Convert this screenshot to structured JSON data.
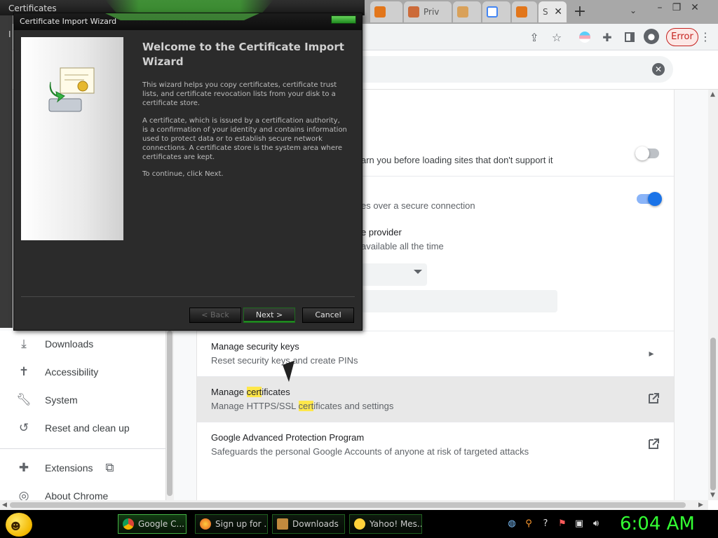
{
  "browser": {
    "tabs": [
      {
        "label": "Certificates",
        "icon": "certificates-window-icon"
      },
      {
        "label": "Priv",
        "icon": "metamask-fox-icon"
      },
      {
        "label": "",
        "icon": "google-g-icon"
      },
      {
        "label": "",
        "icon": "metamask-fox-icon"
      },
      {
        "label": "S",
        "icon": "settings-icon"
      }
    ],
    "error_button": "Error",
    "colors": {
      "accent": "#1a73e8",
      "highlight": "#ffe74a"
    }
  },
  "certs_window": {
    "title": "Certificates",
    "side_labels": [
      "I",
      "",
      ""
    ]
  },
  "wizard": {
    "title": "Certificate Import Wizard",
    "heading": "Welcome to the Certificate Import Wizard",
    "paragraphs": [
      "This wizard helps you copy certificates, certificate trust lists, and certificate revocation lists from your disk to a certificate store.",
      "A certificate, which is issued by a certification authority, is a confirmation of your identity and contains information used to protect data or to establish secure network connections. A certificate store is the system area where certificates are kept.",
      "To continue, click Next."
    ],
    "buttons": {
      "back": "< Back",
      "next": "Next >",
      "cancel": "Cancel"
    }
  },
  "settings": {
    "partial_rows": [
      "arn you before loading sites that don't support it",
      "es over a secure connection",
      "e provider",
      "available all the time"
    ],
    "rows": [
      {
        "title": "Manage security keys",
        "subtitle": "Reset security keys and create PINs"
      },
      {
        "title_parts": [
          "Manage ",
          "cert",
          "ificates"
        ],
        "subtitle_parts": [
          "Manage HTTPS/SSL ",
          "cert",
          "ificates and settings"
        ]
      },
      {
        "title": "Google Advanced Protection Program",
        "subtitle": "Safeguards the personal Google Accounts of anyone at risk of targeted attacks"
      }
    ],
    "toggles": {
      "insecure_warning": false,
      "secure_dns": true
    }
  },
  "sidebar": {
    "items": [
      {
        "label": "Downloads",
        "icon": "download-icon"
      },
      {
        "label": "Accessibility",
        "icon": "accessibility-icon"
      },
      {
        "label": "System",
        "icon": "wrench-icon"
      },
      {
        "label": "Reset and clean up",
        "icon": "restore-icon"
      },
      {
        "label": "Extensions",
        "icon": "puzzle-icon"
      },
      {
        "label": "About Chrome",
        "icon": "chrome-icon"
      }
    ]
  },
  "taskbar": {
    "tasks": [
      {
        "label": "Google C...",
        "icon": "chrome-icon"
      },
      {
        "label": "Sign up for ...",
        "icon": "firefox-icon"
      },
      {
        "label": "Downloads",
        "icon": "folder-icon"
      },
      {
        "label": "Yahoo! Mes...",
        "icon": "yahoo-messenger-icon"
      }
    ],
    "clock": "6:04 AM"
  }
}
